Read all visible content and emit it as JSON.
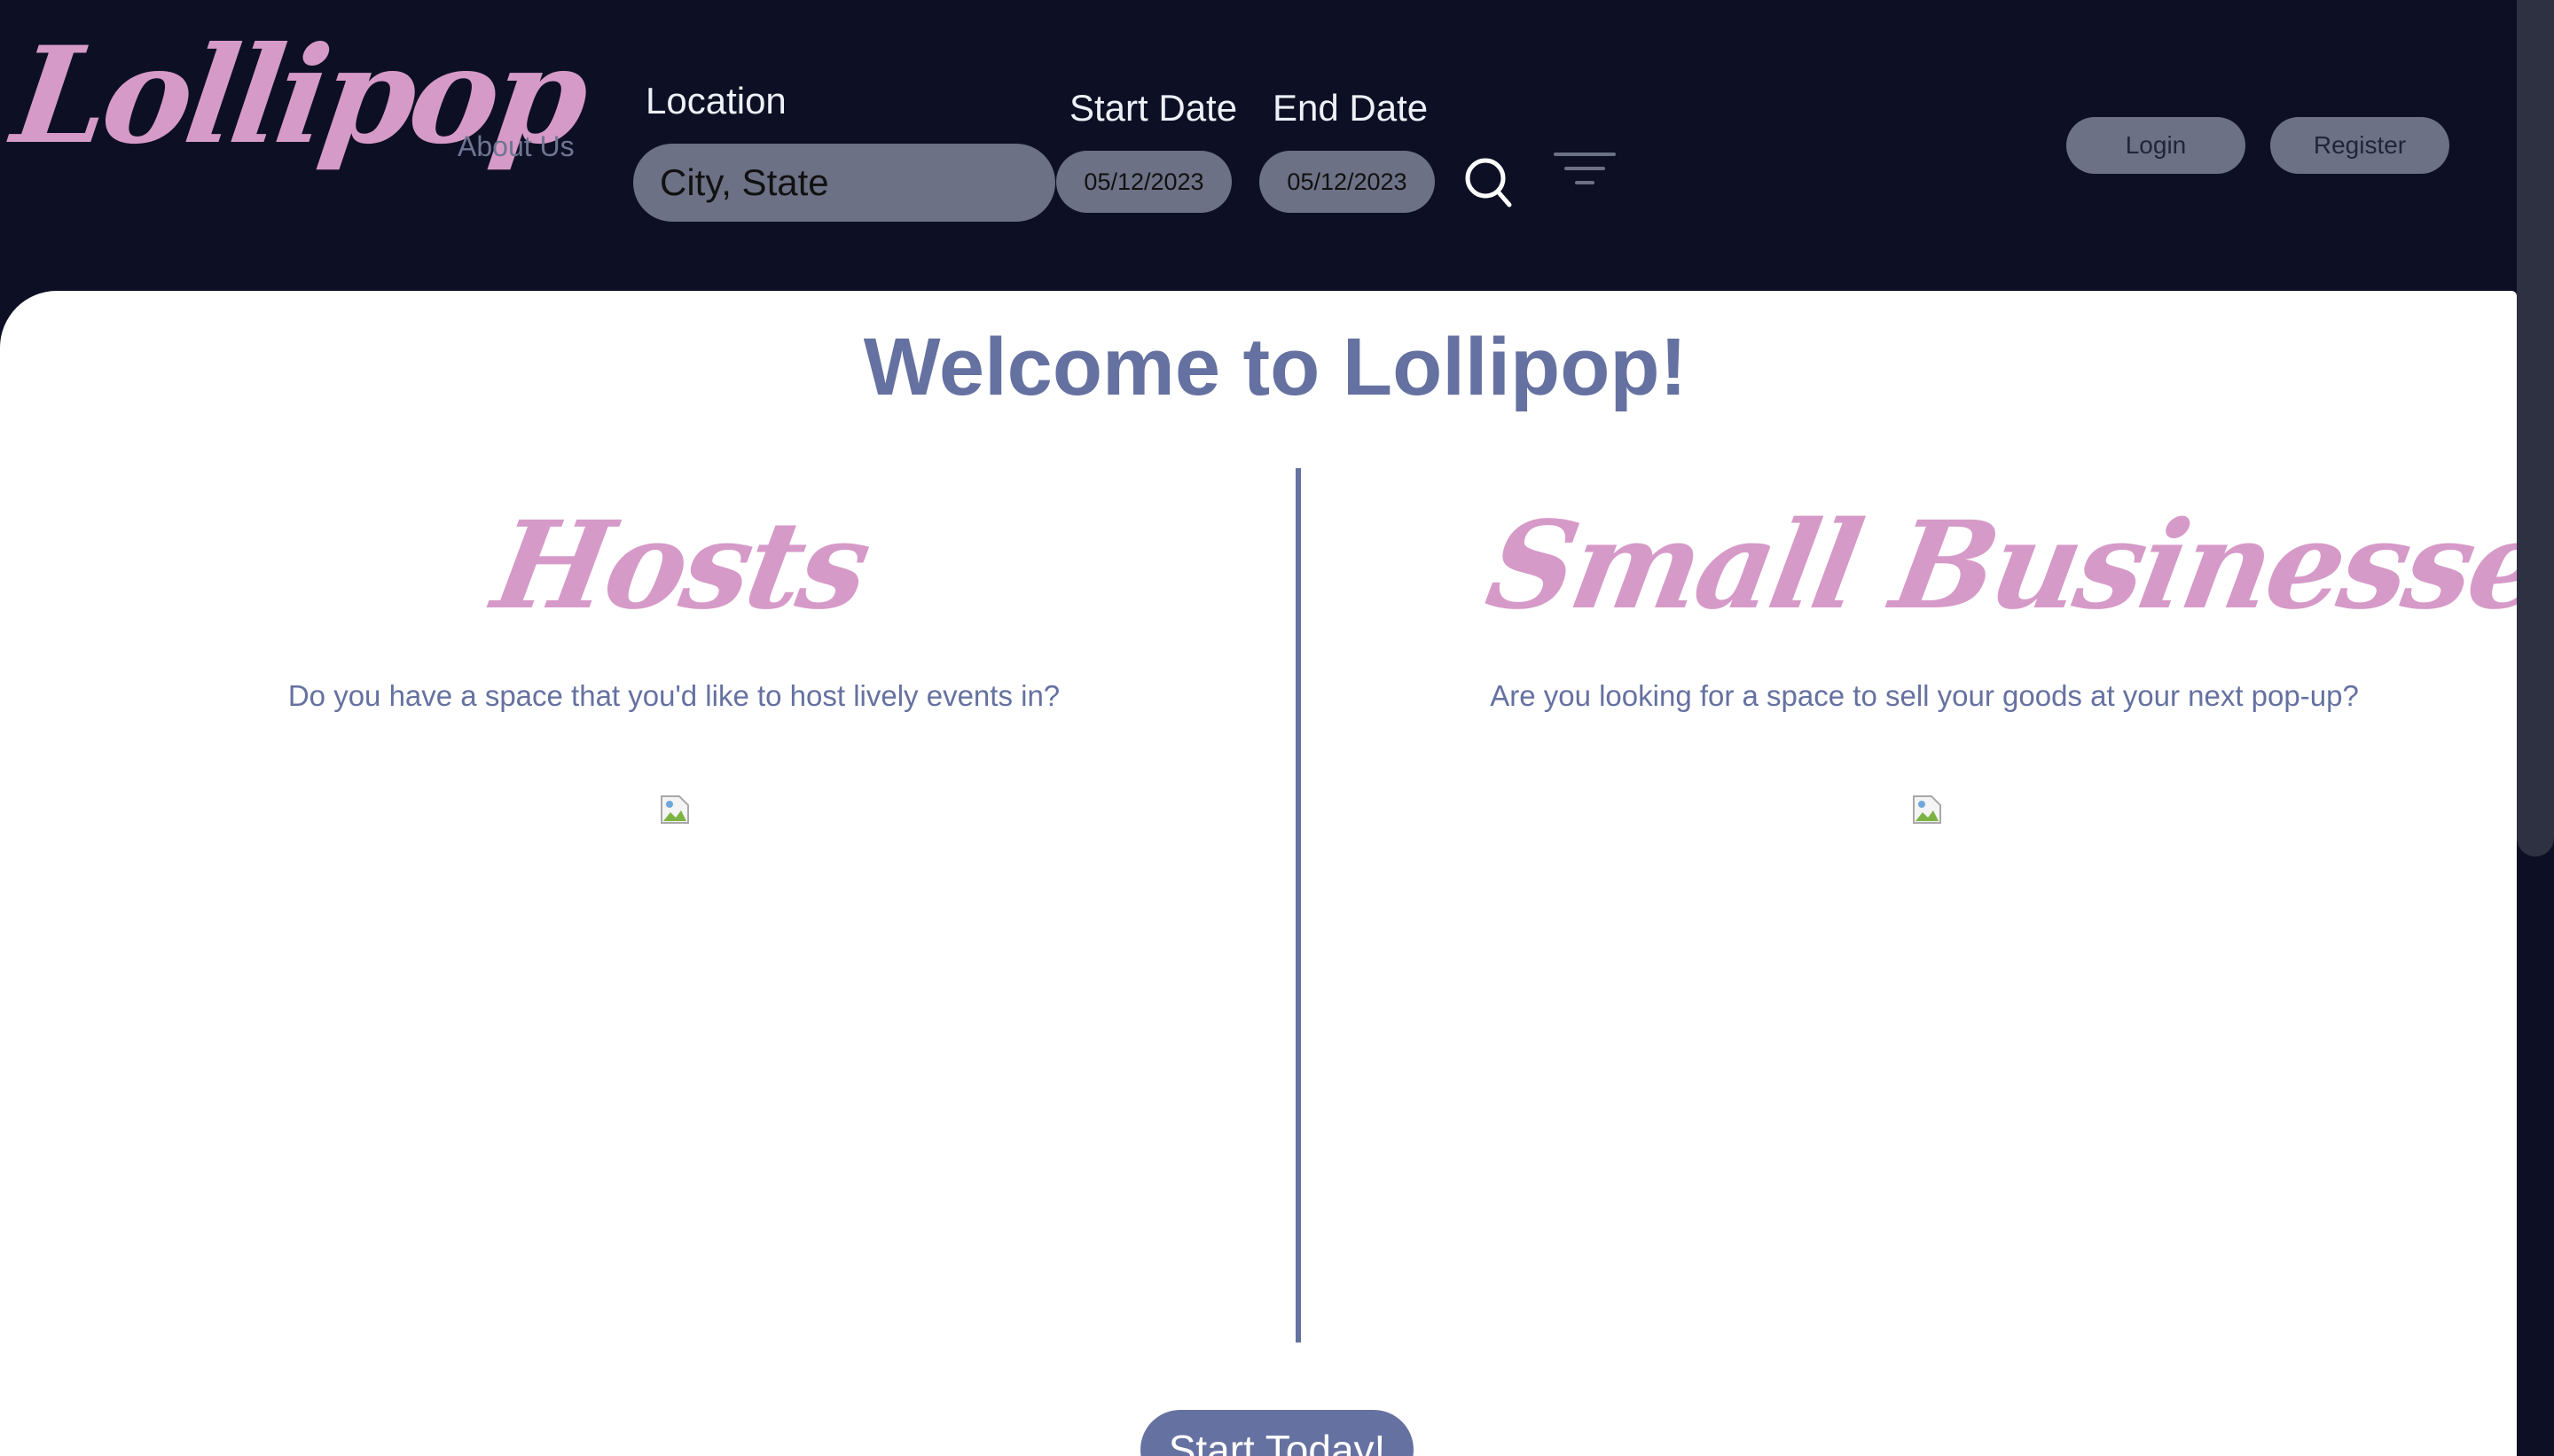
{
  "brand": {
    "logo_text": "Lollipop",
    "logo_color": "#d69ac8"
  },
  "header": {
    "background": "#0d1024",
    "nav_about": "About Us",
    "location_label": "Location",
    "location_placeholder": "City, State",
    "start_date_label": "Start Date",
    "start_date_value": "05/12/2023",
    "end_date_label": "End Date",
    "end_date_value": "05/12/2023",
    "search_icon": "search-icon",
    "filter_icon": "filter-icon",
    "login_label": "Login",
    "register_label": "Register"
  },
  "main": {
    "title": "Welcome to Lollipop!",
    "accent_color": "#6571a0",
    "hosts": {
      "title": "Hosts",
      "description": "Do you have a space that you'd like to host lively events in?",
      "image_icon": "broken-image-icon"
    },
    "small_businesses": {
      "title": "Small Businesses",
      "description": "Are you looking for a space to sell your goods at your next pop-up?",
      "image_icon": "broken-image-icon"
    },
    "cta_label": "Start Today!"
  }
}
